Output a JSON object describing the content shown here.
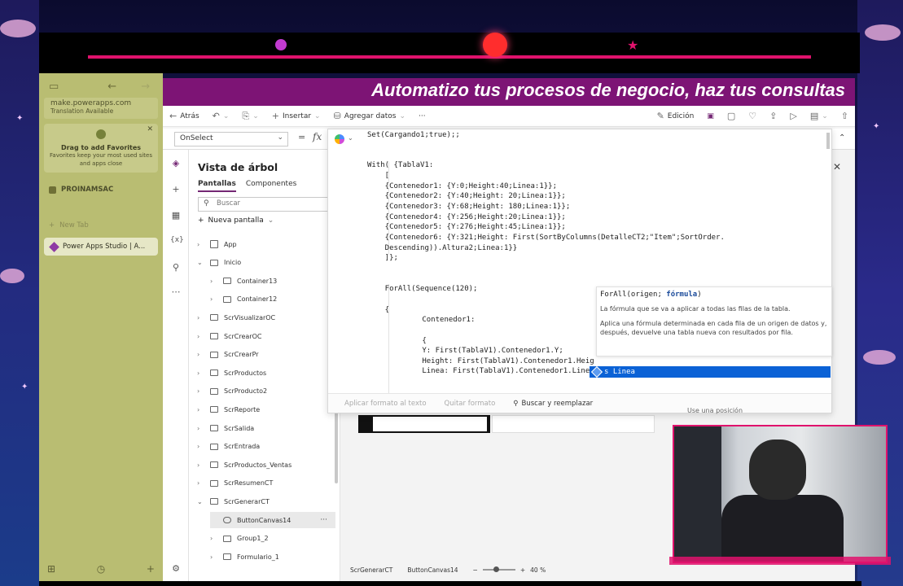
{
  "overlay": {
    "banner_text": "Automatizo tus procesos de negocio, haz tus consultas"
  },
  "browser": {
    "url_host": "make.powerapps.com",
    "url_note": "Translation Available",
    "favorites_title": "Drag to add Favorites",
    "favorites_desc": "Favorites keep your most used sites and apps close",
    "group_label": "PROINAMSAC",
    "new_tab": "New Tab",
    "active_tab": "Power Apps Studio | A..."
  },
  "cmdbar": {
    "back": "Atrás",
    "insert": "Insertar",
    "add_data": "Agregar datos",
    "more": "···",
    "edit_mode": "Edición"
  },
  "formula_bar": {
    "property": "OnSelect",
    "equals": "=",
    "fx": "fx"
  },
  "tree": {
    "title": "Vista de árbol",
    "tab_screens": "Pantallas",
    "tab_components": "Componentes",
    "search_placeholder": "Buscar",
    "new_screen": "Nueva pantalla",
    "items": [
      {
        "label": "App"
      },
      {
        "label": "Inicio"
      },
      {
        "label": "Container13"
      },
      {
        "label": "Container12"
      },
      {
        "label": "ScrVisualizarOC"
      },
      {
        "label": "ScrCrearOC"
      },
      {
        "label": "ScrCrearPr"
      },
      {
        "label": "ScrProductos"
      },
      {
        "label": "ScrProducto2"
      },
      {
        "label": "ScrReporte"
      },
      {
        "label": "ScrSalida"
      },
      {
        "label": "ScrEntrada"
      },
      {
        "label": "ScrProductos_Ventas"
      },
      {
        "label": "ScrResumenCT"
      },
      {
        "label": "ScrGenerarCT"
      },
      {
        "label": "ButtonCanvas14"
      },
      {
        "label": "Group1_2"
      },
      {
        "label": "Formulario_1"
      }
    ]
  },
  "editor": {
    "lines": [
      "Set(Cargando1;true);;",
      "",
      "With( {TablaV1:",
      "    [",
      "    {Contenedor1: {Y:0;Height:40;Linea:1}};",
      "    {Contenedor2: {Y:40;Height: 20;Linea:1}};",
      "    {Contenedor3: {Y:68;Height: 180;Linea:1}};",
      "    {Contenedor4: {Y:256;Height:20;Linea:1}};",
      "    {Contenedor5: {Y:276;Height:45;Linea:1}};",
      "    {Contenedor6: {Y:321;Height: First(SortByColumns(DetalleCT2;\"Item\";SortOrder.",
      "    Descending)).Altura2;Linea:1}}",
      "    ]};",
      "",
      "",
      "    ForAll(Sequence(120);",
      "",
      "    {",
      "        Contenedor1:",
      "",
      "        {",
      "        Y: First(TablaV1).Contenedor1.Y;",
      "        Height: First(TablaV1).Contenedor1.Heig",
      "        Linea: First(TablaV1).Contenedor1.Linea"
    ],
    "footer_format": "Aplicar formato al texto",
    "footer_remove": "Quitar formato",
    "footer_find": "Buscar y reemplazar"
  },
  "intellisense": {
    "signature_fn": "ForAll(origen; ",
    "signature_arg": "fórmula",
    "signature_end": ")",
    "desc1": "La fórmula que se va a aplicar a todas las filas de la tabla.",
    "desc2": "Aplica una fórmula determinada en cada fila de un origen de datos y, después, devuelve una tabla nueva con resultados por fila.",
    "suggestion": "s Linea"
  },
  "props": {
    "partial_text": "Use una posición"
  },
  "status": {
    "screen": "ScrGenerarCT",
    "control": "ButtonCanvas14",
    "zoom": "40 %",
    "zoom_fraction": 0.4
  },
  "colors": {
    "banner": "#7d1475",
    "accent": "#742774",
    "suggest": "#0b62d6",
    "stream_pink": "#e0126c"
  }
}
